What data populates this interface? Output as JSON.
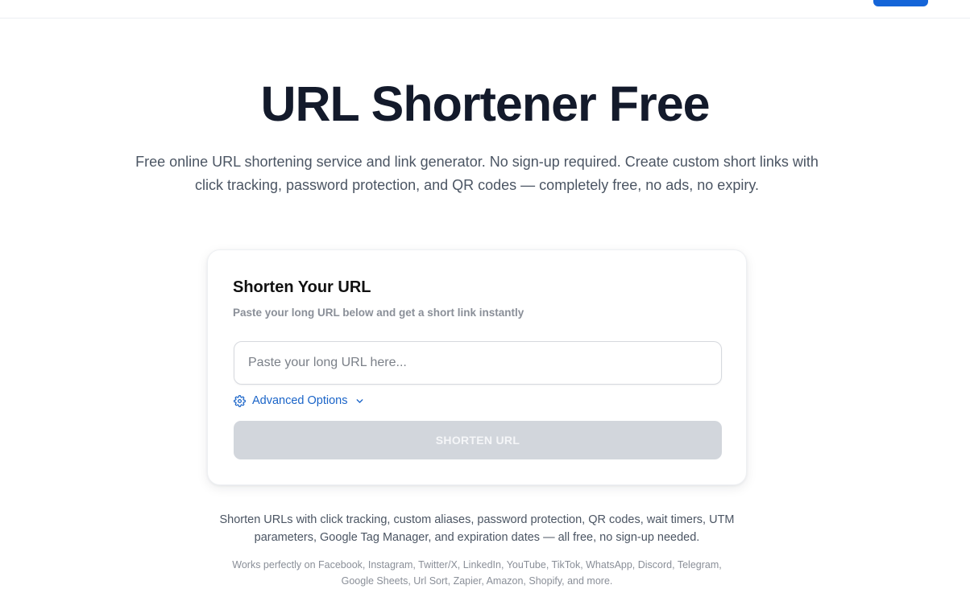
{
  "hero": {
    "title": "URL Shortener Free",
    "subtitle": "Free online URL shortening service and link generator. No sign-up required. Create custom short links with click tracking, password protection, and QR codes — completely free, no ads, no expiry."
  },
  "card": {
    "title": "Shorten Your URL",
    "subtitle": "Paste your long URL below and get a short link instantly",
    "input": {
      "placeholder": "Paste your long URL here...",
      "value": ""
    },
    "advanced_options_label": "Advanced Options",
    "shorten_button_label": "SHORTEN URL"
  },
  "features_text": "Shorten URLs with click tracking, custom aliases, password protection, QR codes, wait timers, UTM parameters, Google Tag Manager, and expiration dates — all free, no sign-up needed.",
  "platforms_text": "Works perfectly on Facebook, Instagram, Twitter/X, LinkedIn, YouTube, TikTok, WhatsApp, Discord, Telegram, Google Sheets, Url Sort, Zapier, Amazon, Shopify, and more.",
  "colors": {
    "accent": "#1565d8",
    "link": "#1a64c8",
    "button_disabled": "#d2d6dc",
    "title": "#131a2b"
  },
  "icons": {
    "advanced": "gear-icon",
    "expand": "chevron-down-icon"
  }
}
